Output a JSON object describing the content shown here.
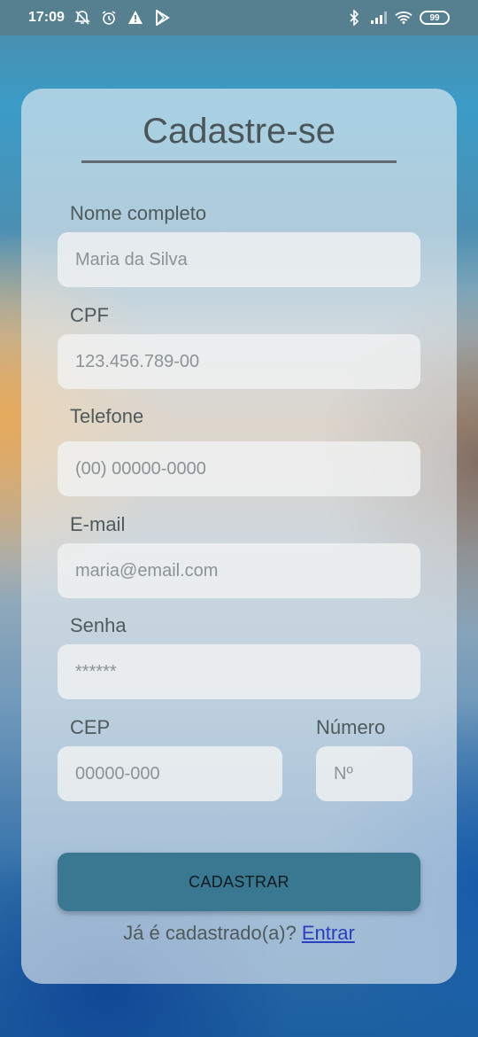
{
  "status_bar": {
    "time": "17:09",
    "battery": "99",
    "left_icons": [
      "mute-bell-icon",
      "alarm-icon",
      "warning-icon",
      "play-store-icon"
    ],
    "right_icons": [
      "bluetooth-icon",
      "signal-icon",
      "wifi-icon",
      "battery-icon"
    ]
  },
  "page": {
    "title": "Cadastre-se"
  },
  "form": {
    "name_label": "Nome completo",
    "name_placeholder": "Maria da Silva",
    "cpf_label": "CPF",
    "cpf_placeholder": "123.456.789-00",
    "phone_label": "Telefone",
    "phone_placeholder": "(00) 00000-0000",
    "email_label": "E-mail",
    "email_placeholder": "maria@email.com",
    "password_label": "Senha",
    "password_placeholder": "******",
    "cep_label": "CEP",
    "cep_placeholder": "00000-000",
    "number_label": "Número",
    "number_placeholder": "Nº",
    "submit_label": "CADASTRAR"
  },
  "footer": {
    "question": "Já é cadastrado(a)?",
    "login_link": "Entrar"
  },
  "colors": {
    "button": "#3a7891",
    "link": "#2a3ec0",
    "status_bar": "#567f8f"
  }
}
